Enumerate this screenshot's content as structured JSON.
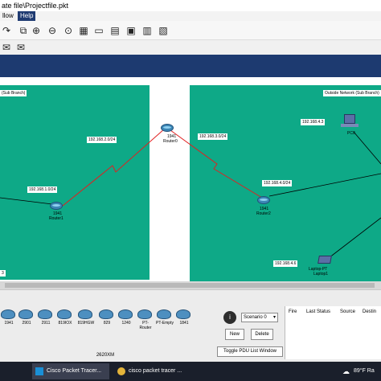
{
  "window": {
    "title": "ate file\\Projectfile.pkt"
  },
  "menu": {
    "items": [
      "llow",
      "Help"
    ]
  },
  "network": {
    "left_zone": {
      "label": "(Sub Branch)",
      "bottom_label": "3"
    },
    "right_zone": {
      "label": "Outside Network (Sub Branch)"
    },
    "central_router": {
      "model": "1941",
      "name": "Router0"
    },
    "router1": {
      "model": "1941",
      "name": "Router1"
    },
    "router2": {
      "model": "1941",
      "name": "Router2"
    },
    "pc": {
      "name": "PC0"
    },
    "laptop": {
      "model": "Laptop-PT",
      "name": "Laptop1"
    },
    "ips": {
      "left_net": "192.168.1.0/24",
      "left_link": "192.168.2.0/24",
      "right_link": "192.168.3.0/24",
      "right_lan": "192.168.4.0/24",
      "pc_ip": "192.168.4.3",
      "laptop_ip": "192.168.4.6"
    }
  },
  "devices": {
    "items": [
      "1941",
      "2901",
      "2911",
      "819IOX",
      "819HGW",
      "829",
      "1240",
      "PT-Router",
      "PT-Empty",
      "1841"
    ],
    "model": "2620XM"
  },
  "pdu": {
    "scenario": "Scenario 0",
    "info_label": "i",
    "new": "New",
    "delete": "Delete",
    "toggle": "Toggle PDU List Window",
    "columns": [
      "Fire",
      "Last Status",
      "Source",
      "Destin"
    ]
  },
  "taskbar": {
    "item1": "Cisco Packet Tracer...",
    "item2": "cisco packet tracer ...",
    "weather": "89°F Ra"
  }
}
